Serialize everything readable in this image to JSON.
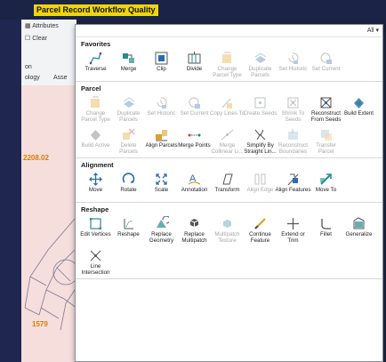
{
  "ribbon": {
    "tabs": [
      {
        "label": "Parcel Record Workflows"
      },
      {
        "label": "Quality"
      }
    ]
  },
  "left_panel": {
    "attributes": "Attributes",
    "clear": "Clear",
    "on": "on",
    "tab_ology": "ology",
    "tab_ass": "Asse"
  },
  "map": {
    "label_1": "2208.02",
    "label_2": "1579"
  },
  "gallery": {
    "filter": "All",
    "sections": [
      {
        "title": "Favorites",
        "tools": [
          {
            "label": "Traverse",
            "enabled": true,
            "icon": "traverse-icon"
          },
          {
            "label": "Merge",
            "enabled": true,
            "icon": "merge-icon"
          },
          {
            "label": "Clip",
            "enabled": true,
            "icon": "clip-icon"
          },
          {
            "label": "Divide",
            "enabled": true,
            "icon": "divide-icon"
          },
          {
            "label": "Change Parcel Type",
            "enabled": false,
            "icon": "change-parcel-type-icon"
          },
          {
            "label": "Duplicate Parcels",
            "enabled": false,
            "icon": "duplicate-parcels-icon"
          },
          {
            "label": "Set Historic",
            "enabled": false,
            "icon": "set-historic-icon"
          },
          {
            "label": "Set Current",
            "enabled": false,
            "icon": "set-current-icon"
          }
        ]
      },
      {
        "title": "Parcel",
        "tools": [
          {
            "label": "Change Parcel Type",
            "enabled": false,
            "icon": "change-parcel-type-icon"
          },
          {
            "label": "Duplicate Parcels",
            "enabled": false,
            "icon": "duplicate-parcels-icon"
          },
          {
            "label": "Set Historic",
            "enabled": false,
            "icon": "set-historic-icon"
          },
          {
            "label": "Set Current",
            "enabled": false,
            "icon": "set-current-icon"
          },
          {
            "label": "Copy Lines To",
            "enabled": false,
            "icon": "copy-lines-icon"
          },
          {
            "label": "Create Seeds",
            "enabled": false,
            "icon": "create-seeds-icon"
          },
          {
            "label": "Shrink To Seeds",
            "enabled": false,
            "icon": "shrink-to-seeds-icon"
          },
          {
            "label": "Reconstruct From Seeds",
            "enabled": true,
            "icon": "reconstruct-from-seeds-icon"
          },
          {
            "label": "Build Extent",
            "enabled": true,
            "icon": "build-extent-icon"
          },
          {
            "label": "Build Active",
            "enabled": false,
            "icon": "build-active-icon"
          },
          {
            "label": "Delete Parcels",
            "enabled": false,
            "icon": "delete-parcels-icon"
          },
          {
            "label": "Align Parcels",
            "enabled": true,
            "icon": "align-parcels-icon"
          },
          {
            "label": "Merge Points",
            "enabled": true,
            "icon": "merge-points-icon"
          },
          {
            "label": "Merge Collinear Li...",
            "enabled": false,
            "icon": "merge-collinear-icon"
          },
          {
            "label": "Simplify By Straight Lin...",
            "enabled": true,
            "icon": "simplify-icon"
          },
          {
            "label": "Reconstruct Boundaries",
            "enabled": false,
            "icon": "reconstruct-boundaries-icon"
          },
          {
            "label": "Transfer Parcel",
            "enabled": false,
            "icon": "transfer-parcel-icon"
          }
        ]
      },
      {
        "title": "Alignment",
        "tools": [
          {
            "label": "Move",
            "enabled": true,
            "icon": "move-icon"
          },
          {
            "label": "Rotate",
            "enabled": true,
            "icon": "rotate-icon"
          },
          {
            "label": "Scale",
            "enabled": true,
            "icon": "scale-icon"
          },
          {
            "label": "Annotation",
            "enabled": true,
            "icon": "annotation-icon"
          },
          {
            "label": "Transform",
            "enabled": true,
            "icon": "transform-icon"
          },
          {
            "label": "Align Edge",
            "enabled": false,
            "icon": "align-edge-icon"
          },
          {
            "label": "Align Features",
            "enabled": true,
            "icon": "align-features-icon"
          },
          {
            "label": "Move To",
            "enabled": true,
            "icon": "move-to-icon"
          }
        ]
      },
      {
        "title": "Reshape",
        "tools": [
          {
            "label": "Edit Vertices",
            "enabled": true,
            "icon": "edit-vertices-icon"
          },
          {
            "label": "Reshape",
            "enabled": true,
            "icon": "reshape-icon"
          },
          {
            "label": "Replace Geometry",
            "enabled": true,
            "icon": "replace-geometry-icon"
          },
          {
            "label": "Replace Multipatch",
            "enabled": true,
            "icon": "replace-multipatch-icon"
          },
          {
            "label": "Multipatch Texture",
            "enabled": false,
            "icon": "multipatch-texture-icon"
          },
          {
            "label": "Continue Feature",
            "enabled": true,
            "icon": "continue-feature-icon"
          },
          {
            "label": "Extend or Trim",
            "enabled": true,
            "icon": "extend-trim-icon"
          },
          {
            "label": "Fillet",
            "enabled": true,
            "icon": "fillet-icon"
          },
          {
            "label": "Generalize",
            "enabled": true,
            "icon": "generalize-icon"
          },
          {
            "label": "Line Intersection",
            "enabled": true,
            "icon": "line-intersection-icon"
          }
        ]
      }
    ]
  },
  "colors": {
    "accent": "#f1d50b",
    "map_label": "#e07b00",
    "icon_teal": "#2a8c8c",
    "icon_blue": "#2b6cb0"
  }
}
